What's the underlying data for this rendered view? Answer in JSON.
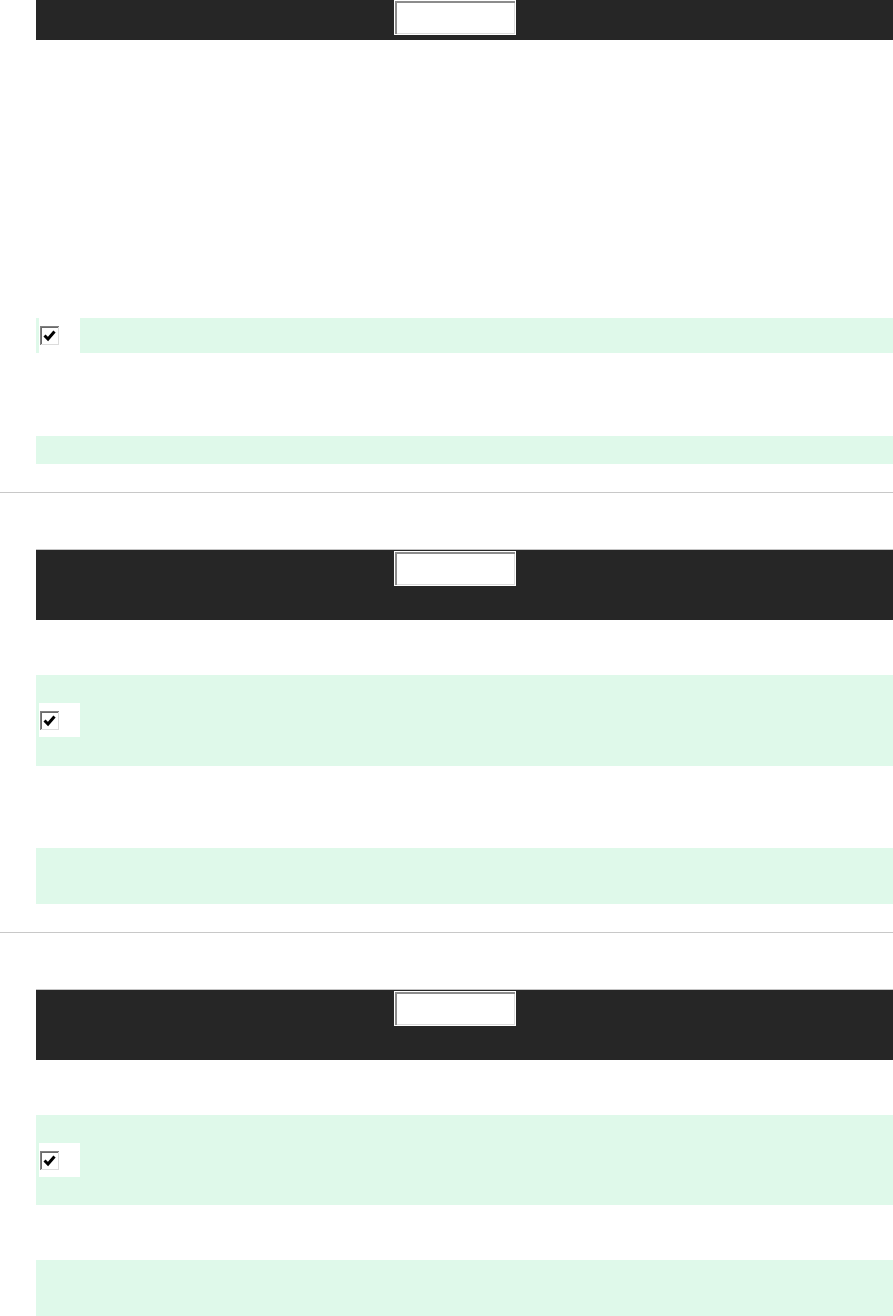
{
  "panels": [
    {
      "checkbox": {
        "checked": true
      }
    },
    {
      "checkbox": {
        "checked": true
      }
    },
    {
      "checkbox": {
        "checked": true
      }
    }
  ]
}
